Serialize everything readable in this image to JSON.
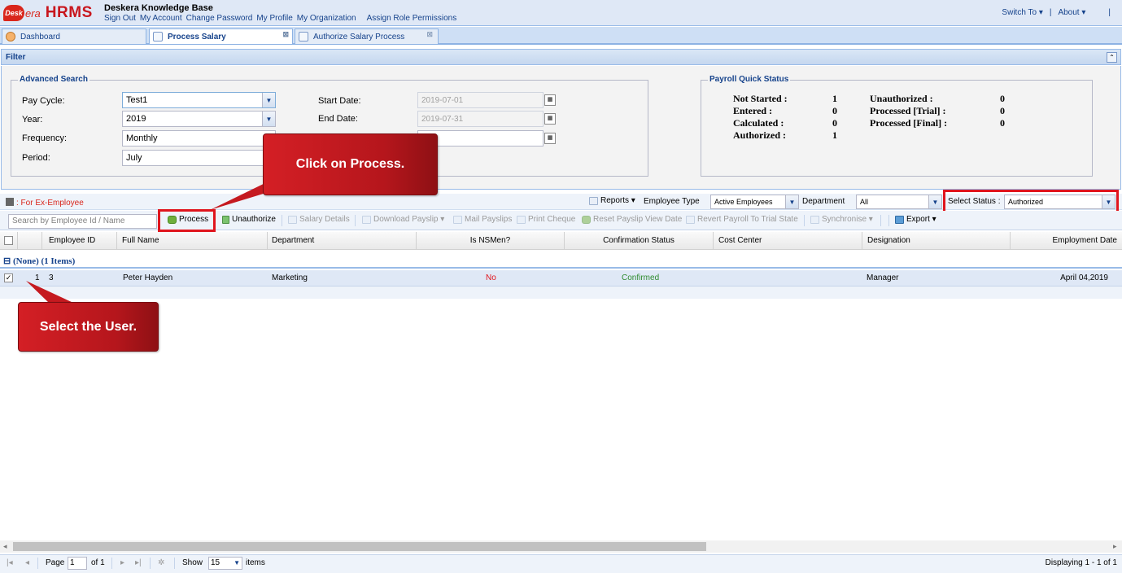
{
  "header": {
    "logo_text_1": "Desk",
    "logo_text_2": "era",
    "logo_text_3": "HRMS",
    "title": "Deskera Knowledge Base",
    "links": [
      "Sign Out",
      "My Account",
      "Change Password",
      "My Profile",
      "My Organization",
      "Assign Role Permissions"
    ],
    "switch_to": "Switch To ▾",
    "about": "About ▾",
    "divider": "|"
  },
  "tabs": [
    {
      "label": "Dashboard"
    },
    {
      "label": "Process Salary"
    },
    {
      "label": "Authorize Salary Process"
    }
  ],
  "filter": {
    "title": "Filter",
    "advanced_search": {
      "legend": "Advanced Search",
      "pay_cycle_label": "Pay Cycle:",
      "pay_cycle_value": "Test1",
      "year_label": "Year:",
      "year_value": "2019",
      "frequency_label": "Frequency:",
      "frequency_value": "Monthly",
      "period_label": "Period:",
      "period_value": "July",
      "start_date_label": "Start Date:",
      "start_date_value": "2019-07-01",
      "end_date_label": "End Date:",
      "end_date_value": "2019-07-31"
    },
    "quick_status": {
      "legend": "Payroll Quick Status",
      "not_started_label": "Not Started :",
      "not_started": "1",
      "entered_label": "Entered :",
      "entered": "0",
      "calculated_label": "Calculated :",
      "calculated": "0",
      "authorized_label": "Authorized :",
      "authorized": "1",
      "unauthorized_label": "Unauthorized :",
      "unauthorized": "0",
      "processed_trial_label": "Processed [Trial] :",
      "processed_trial": "0",
      "processed_final_label": "Processed [Final] :",
      "processed_final": "0"
    }
  },
  "toolbar1": {
    "ex_employee": ": For Ex-Employee",
    "reports": "Reports ▾",
    "employee_type_label": "Employee Type",
    "employee_type_value": "Active Employees",
    "department_label": "Department",
    "department_value": "All",
    "select_status_label": "Select Status :",
    "select_status_value": "Authorized"
  },
  "toolbar2": {
    "search_placeholder": "Search by Employee Id / Name",
    "process": "Process",
    "unauthorize": "Unauthorize",
    "salary_details": "Salary Details",
    "download_payslip": "Download Payslip ▾",
    "mail_payslips": "Mail Payslips",
    "print_cheque": "Print Cheque",
    "reset_payslip": "Reset Payslip View Date",
    "revert_payroll": "Revert Payroll To Trial State",
    "synchronise": "Synchronise ▾",
    "export": "Export ▾"
  },
  "grid": {
    "columns": [
      "Employee ID",
      "Full Name",
      "Department",
      "Is NSMen?",
      "Confirmation Status",
      "Cost Center",
      "Designation",
      "Employment Date"
    ],
    "group_label": "⊟ (None) (1 Items)",
    "rows": [
      {
        "num": "1",
        "employee_id": "3",
        "full_name": "Peter Hayden",
        "department": "Marketing",
        "is_nsmen": "No",
        "confirmation": "Confirmed",
        "cost_center": "",
        "designation": "Manager",
        "employment_date": "April 04,2019"
      }
    ]
  },
  "callouts": {
    "process": "Click on Process.",
    "select_user": "Select the User."
  },
  "pager": {
    "page_label": "Page",
    "page_value": "1",
    "of_label": "of 1",
    "show_label": "Show",
    "show_value": "15",
    "items_label": "items",
    "displaying": "Displaying 1 - 1 of 1"
  },
  "colors": {
    "accent_red": "#d41f25",
    "header_bg": "#dfe8f6",
    "row_selected": "#dfe8f6"
  }
}
